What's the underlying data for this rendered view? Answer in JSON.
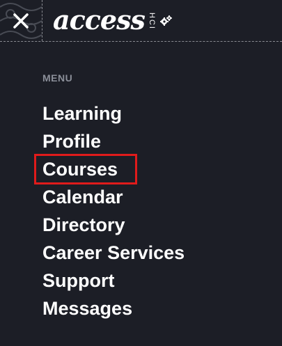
{
  "header": {
    "logo_text": "access",
    "logo_subtext": "HCI",
    "close_icon": "close-icon",
    "settings_icon": "gears-icon"
  },
  "menu": {
    "heading": "MENU",
    "items": [
      {
        "label": "Learning"
      },
      {
        "label": "Profile"
      },
      {
        "label": "Courses",
        "highlighted": true
      },
      {
        "label": "Calendar"
      },
      {
        "label": "Directory"
      },
      {
        "label": "Career Services"
      },
      {
        "label": "Support"
      },
      {
        "label": "Messages"
      }
    ]
  },
  "colors": {
    "background": "#1c1e26",
    "text": "#ffffff",
    "heading": "#8b8f99",
    "highlight": "#e01b1b"
  }
}
